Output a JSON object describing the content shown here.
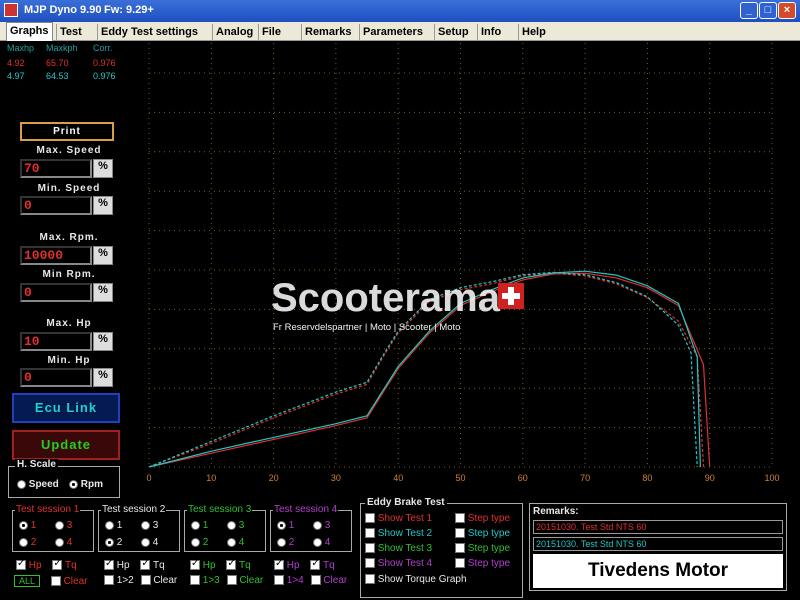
{
  "window": {
    "title": "MJP Dyno 9.90",
    "firmware": "Fw: 9.29+"
  },
  "menu": [
    "Graphs",
    "Test",
    "Eddy Test settings",
    "Analog",
    "File",
    "Remarks",
    "Parameters",
    "Setup",
    "Info",
    "Help"
  ],
  "stats": {
    "headers": [
      "Maxhp",
      "Maxkph",
      "Corr."
    ],
    "row1": [
      "4.92",
      "65.70",
      "0.976"
    ],
    "row2": [
      "4.97",
      "64.53",
      "0.976"
    ]
  },
  "controls": {
    "print": "Print",
    "max_speed_label": "Max. Speed",
    "max_speed": "70",
    "min_speed_label": "Min. Speed",
    "min_speed": "0",
    "max_rpm_label": "Max. Rpm.",
    "max_rpm": "10000",
    "min_rpm_label": "Min Rpm.",
    "min_rpm": "0",
    "max_hp_label": "Max. Hp",
    "max_hp": "10",
    "min_hp_label": "Min. Hp",
    "min_hp": "0",
    "pct": "%",
    "ecu_link": "Ecu Link",
    "update": "Update"
  },
  "hscale": {
    "title": "H. Scale",
    "speed": "Speed",
    "rpm": "Rpm"
  },
  "sessions": [
    {
      "title": "Test session 1",
      "color": "#e03030",
      "opts": [
        "1",
        "3",
        "2",
        "4"
      ]
    },
    {
      "title": "Test session 2",
      "color": "#e8e8e8",
      "opts": [
        "1",
        "3",
        "2",
        "4"
      ]
    },
    {
      "title": "Test session 3",
      "color": "#30c030",
      "opts": [
        "1",
        "3",
        "2",
        "4"
      ]
    },
    {
      "title": "Test session 4",
      "color": "#b040d0",
      "opts": [
        "1",
        "3",
        "2",
        "4"
      ]
    }
  ],
  "bottom": {
    "all": "ALL",
    "hp": "Hp",
    "tq": "Tq",
    "clear": "Clear",
    "c12": "1>2",
    "c13": "1>3",
    "c14": "1>4"
  },
  "eddy": {
    "title": "Eddy Brake Test",
    "show1": "Show Test 1",
    "show2": "Show Test 2",
    "show3": "Show Test 3",
    "show4": "Show Test 4",
    "step": "Step type",
    "torque": "Show Torque Graph"
  },
  "remarks": {
    "title": "Remarks:",
    "r1": "20151030. Test Std NTS 60",
    "r2": "20151030. Test Std NTS 60",
    "company": "Tivedens Motor"
  },
  "watermark": {
    "name": "Scooterama",
    "tagline": "Fr Reservdelspartner | Moto | Scooter | Moto"
  },
  "chart_data": {
    "type": "line",
    "xlim": [
      0,
      100
    ],
    "ylim": [
      0,
      10
    ],
    "x_ticks": [
      0,
      10,
      20,
      30,
      40,
      50,
      60,
      70,
      80,
      90,
      100
    ],
    "y_ticks": [
      0,
      1,
      2,
      3,
      4,
      5,
      6,
      7,
      8,
      9,
      10
    ],
    "grid": true,
    "series": [
      {
        "color": "#e03030",
        "points": [
          [
            0,
            0
          ],
          [
            10,
            0.35
          ],
          [
            20,
            0.7
          ],
          [
            30,
            1.05
          ],
          [
            35,
            1.25
          ],
          [
            38,
            2.0
          ],
          [
            40,
            2.5
          ],
          [
            45,
            3.4
          ],
          [
            50,
            4.1
          ],
          [
            55,
            4.45
          ],
          [
            60,
            4.75
          ],
          [
            65,
            4.9
          ],
          [
            70,
            4.92
          ],
          [
            75,
            4.8
          ],
          [
            80,
            4.55
          ],
          [
            85,
            4.1
          ],
          [
            89,
            2.6
          ],
          [
            90,
            0
          ]
        ]
      },
      {
        "color": "#e03030",
        "points": [
          [
            0,
            0
          ],
          [
            10,
            0.6
          ],
          [
            20,
            1.25
          ],
          [
            30,
            1.85
          ],
          [
            35,
            2.1
          ],
          [
            38,
            2.9
          ],
          [
            40,
            3.4
          ],
          [
            45,
            4.2
          ],
          [
            50,
            4.5
          ],
          [
            55,
            4.65
          ],
          [
            60,
            4.85
          ],
          [
            65,
            4.92
          ],
          [
            70,
            4.85
          ],
          [
            75,
            4.65
          ],
          [
            80,
            4.3
          ],
          [
            85,
            3.7
          ],
          [
            88,
            2.8
          ],
          [
            89,
            0
          ]
        ]
      },
      {
        "color": "#20c8c8",
        "points": [
          [
            0,
            0
          ],
          [
            10,
            0.4
          ],
          [
            20,
            0.75
          ],
          [
            30,
            1.1
          ],
          [
            35,
            1.3
          ],
          [
            38,
            2.05
          ],
          [
            40,
            2.55
          ],
          [
            45,
            3.45
          ],
          [
            50,
            4.15
          ],
          [
            55,
            4.5
          ],
          [
            60,
            4.8
          ],
          [
            65,
            4.93
          ],
          [
            70,
            4.97
          ],
          [
            75,
            4.87
          ],
          [
            80,
            4.6
          ],
          [
            85,
            4.15
          ],
          [
            88,
            2.8
          ],
          [
            88.5,
            0
          ]
        ]
      },
      {
        "color": "#20c8c8",
        "points": [
          [
            0,
            0
          ],
          [
            10,
            0.65
          ],
          [
            20,
            1.3
          ],
          [
            30,
            1.9
          ],
          [
            35,
            2.15
          ],
          [
            38,
            2.95
          ],
          [
            40,
            3.45
          ],
          [
            45,
            4.25
          ],
          [
            50,
            4.55
          ],
          [
            55,
            4.7
          ],
          [
            60,
            4.88
          ],
          [
            65,
            4.94
          ],
          [
            70,
            4.88
          ],
          [
            75,
            4.68
          ],
          [
            80,
            4.32
          ],
          [
            85,
            3.6
          ],
          [
            87,
            2.9
          ],
          [
            88,
            0
          ]
        ]
      }
    ]
  }
}
